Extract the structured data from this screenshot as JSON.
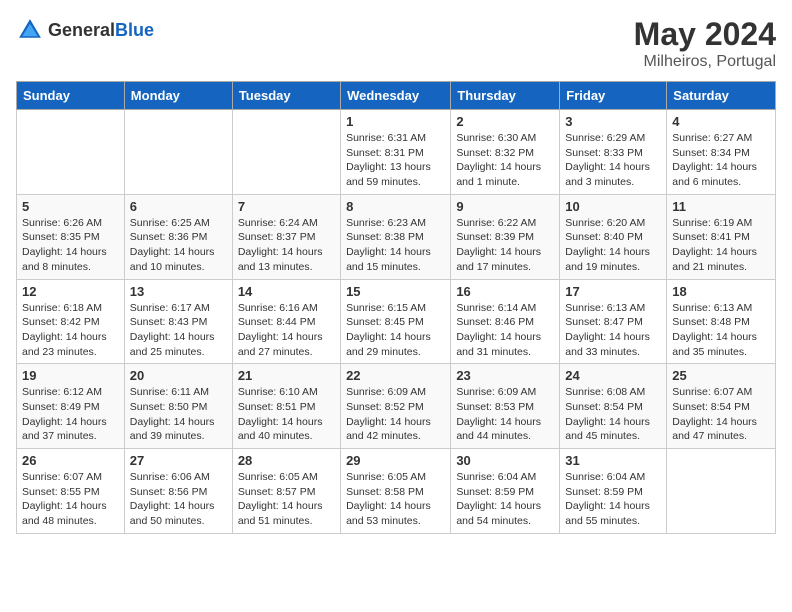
{
  "header": {
    "logo_general": "General",
    "logo_blue": "Blue",
    "month_year": "May 2024",
    "location": "Milheiros, Portugal"
  },
  "weekdays": [
    "Sunday",
    "Monday",
    "Tuesday",
    "Wednesday",
    "Thursday",
    "Friday",
    "Saturday"
  ],
  "weeks": [
    [
      {
        "day": "",
        "sunrise": "",
        "sunset": "",
        "daylight": ""
      },
      {
        "day": "",
        "sunrise": "",
        "sunset": "",
        "daylight": ""
      },
      {
        "day": "",
        "sunrise": "",
        "sunset": "",
        "daylight": ""
      },
      {
        "day": "1",
        "sunrise": "Sunrise: 6:31 AM",
        "sunset": "Sunset: 8:31 PM",
        "daylight": "Daylight: 13 hours and 59 minutes."
      },
      {
        "day": "2",
        "sunrise": "Sunrise: 6:30 AM",
        "sunset": "Sunset: 8:32 PM",
        "daylight": "Daylight: 14 hours and 1 minute."
      },
      {
        "day": "3",
        "sunrise": "Sunrise: 6:29 AM",
        "sunset": "Sunset: 8:33 PM",
        "daylight": "Daylight: 14 hours and 3 minutes."
      },
      {
        "day": "4",
        "sunrise": "Sunrise: 6:27 AM",
        "sunset": "Sunset: 8:34 PM",
        "daylight": "Daylight: 14 hours and 6 minutes."
      }
    ],
    [
      {
        "day": "5",
        "sunrise": "Sunrise: 6:26 AM",
        "sunset": "Sunset: 8:35 PM",
        "daylight": "Daylight: 14 hours and 8 minutes."
      },
      {
        "day": "6",
        "sunrise": "Sunrise: 6:25 AM",
        "sunset": "Sunset: 8:36 PM",
        "daylight": "Daylight: 14 hours and 10 minutes."
      },
      {
        "day": "7",
        "sunrise": "Sunrise: 6:24 AM",
        "sunset": "Sunset: 8:37 PM",
        "daylight": "Daylight: 14 hours and 13 minutes."
      },
      {
        "day": "8",
        "sunrise": "Sunrise: 6:23 AM",
        "sunset": "Sunset: 8:38 PM",
        "daylight": "Daylight: 14 hours and 15 minutes."
      },
      {
        "day": "9",
        "sunrise": "Sunrise: 6:22 AM",
        "sunset": "Sunset: 8:39 PM",
        "daylight": "Daylight: 14 hours and 17 minutes."
      },
      {
        "day": "10",
        "sunrise": "Sunrise: 6:20 AM",
        "sunset": "Sunset: 8:40 PM",
        "daylight": "Daylight: 14 hours and 19 minutes."
      },
      {
        "day": "11",
        "sunrise": "Sunrise: 6:19 AM",
        "sunset": "Sunset: 8:41 PM",
        "daylight": "Daylight: 14 hours and 21 minutes."
      }
    ],
    [
      {
        "day": "12",
        "sunrise": "Sunrise: 6:18 AM",
        "sunset": "Sunset: 8:42 PM",
        "daylight": "Daylight: 14 hours and 23 minutes."
      },
      {
        "day": "13",
        "sunrise": "Sunrise: 6:17 AM",
        "sunset": "Sunset: 8:43 PM",
        "daylight": "Daylight: 14 hours and 25 minutes."
      },
      {
        "day": "14",
        "sunrise": "Sunrise: 6:16 AM",
        "sunset": "Sunset: 8:44 PM",
        "daylight": "Daylight: 14 hours and 27 minutes."
      },
      {
        "day": "15",
        "sunrise": "Sunrise: 6:15 AM",
        "sunset": "Sunset: 8:45 PM",
        "daylight": "Daylight: 14 hours and 29 minutes."
      },
      {
        "day": "16",
        "sunrise": "Sunrise: 6:14 AM",
        "sunset": "Sunset: 8:46 PM",
        "daylight": "Daylight: 14 hours and 31 minutes."
      },
      {
        "day": "17",
        "sunrise": "Sunrise: 6:13 AM",
        "sunset": "Sunset: 8:47 PM",
        "daylight": "Daylight: 14 hours and 33 minutes."
      },
      {
        "day": "18",
        "sunrise": "Sunrise: 6:13 AM",
        "sunset": "Sunset: 8:48 PM",
        "daylight": "Daylight: 14 hours and 35 minutes."
      }
    ],
    [
      {
        "day": "19",
        "sunrise": "Sunrise: 6:12 AM",
        "sunset": "Sunset: 8:49 PM",
        "daylight": "Daylight: 14 hours and 37 minutes."
      },
      {
        "day": "20",
        "sunrise": "Sunrise: 6:11 AM",
        "sunset": "Sunset: 8:50 PM",
        "daylight": "Daylight: 14 hours and 39 minutes."
      },
      {
        "day": "21",
        "sunrise": "Sunrise: 6:10 AM",
        "sunset": "Sunset: 8:51 PM",
        "daylight": "Daylight: 14 hours and 40 minutes."
      },
      {
        "day": "22",
        "sunrise": "Sunrise: 6:09 AM",
        "sunset": "Sunset: 8:52 PM",
        "daylight": "Daylight: 14 hours and 42 minutes."
      },
      {
        "day": "23",
        "sunrise": "Sunrise: 6:09 AM",
        "sunset": "Sunset: 8:53 PM",
        "daylight": "Daylight: 14 hours and 44 minutes."
      },
      {
        "day": "24",
        "sunrise": "Sunrise: 6:08 AM",
        "sunset": "Sunset: 8:54 PM",
        "daylight": "Daylight: 14 hours and 45 minutes."
      },
      {
        "day": "25",
        "sunrise": "Sunrise: 6:07 AM",
        "sunset": "Sunset: 8:54 PM",
        "daylight": "Daylight: 14 hours and 47 minutes."
      }
    ],
    [
      {
        "day": "26",
        "sunrise": "Sunrise: 6:07 AM",
        "sunset": "Sunset: 8:55 PM",
        "daylight": "Daylight: 14 hours and 48 minutes."
      },
      {
        "day": "27",
        "sunrise": "Sunrise: 6:06 AM",
        "sunset": "Sunset: 8:56 PM",
        "daylight": "Daylight: 14 hours and 50 minutes."
      },
      {
        "day": "28",
        "sunrise": "Sunrise: 6:05 AM",
        "sunset": "Sunset: 8:57 PM",
        "daylight": "Daylight: 14 hours and 51 minutes."
      },
      {
        "day": "29",
        "sunrise": "Sunrise: 6:05 AM",
        "sunset": "Sunset: 8:58 PM",
        "daylight": "Daylight: 14 hours and 53 minutes."
      },
      {
        "day": "30",
        "sunrise": "Sunrise: 6:04 AM",
        "sunset": "Sunset: 8:59 PM",
        "daylight": "Daylight: 14 hours and 54 minutes."
      },
      {
        "day": "31",
        "sunrise": "Sunrise: 6:04 AM",
        "sunset": "Sunset: 8:59 PM",
        "daylight": "Daylight: 14 hours and 55 minutes."
      },
      {
        "day": "",
        "sunrise": "",
        "sunset": "",
        "daylight": ""
      }
    ]
  ]
}
